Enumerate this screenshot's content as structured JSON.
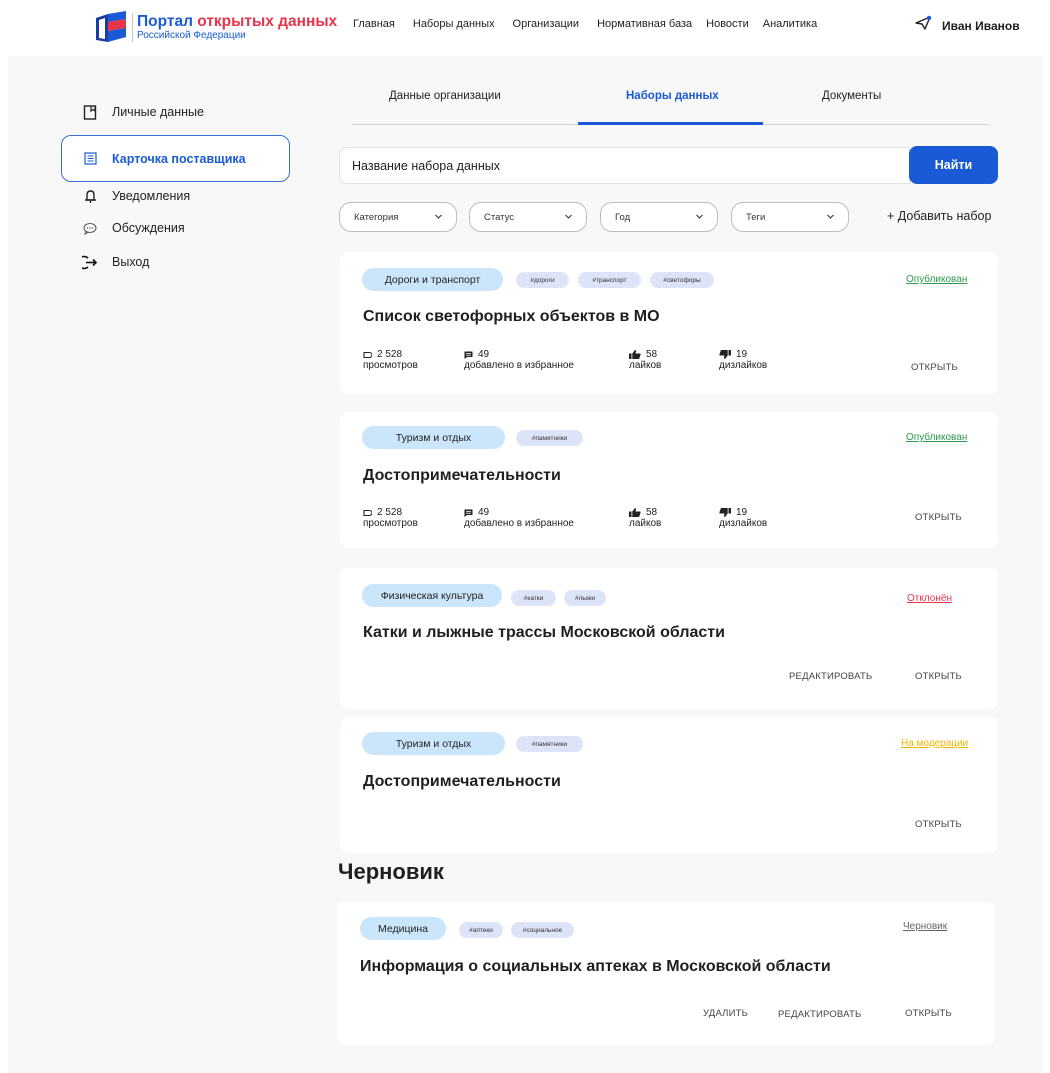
{
  "colors": {
    "accent": "#1a5ad7",
    "brand_red": "#e8344a",
    "published": "#2e9a4f",
    "rejected": "#e8344a",
    "moderation": "#f0b400",
    "draft": "#666666"
  },
  "header": {
    "logo": {
      "title_part1": "Портал",
      "title_part2": "открытых данных",
      "subtitle": "Российской Федерации"
    },
    "nav": [
      "Главная",
      "Наборы данных",
      "Организации",
      "Нормативная база",
      "Новости",
      "Аналитика"
    ],
    "user": {
      "icon": "send-icon",
      "name": "Иван Иванов"
    }
  },
  "sidebar": {
    "items": [
      {
        "label": "Личные данные",
        "icon": "bookmark-icon"
      },
      {
        "label": "Карточка поставщика",
        "icon": "list-card-icon",
        "active": true
      },
      {
        "label": "Уведомления",
        "icon": "bell-icon"
      },
      {
        "label": "Обсуждения",
        "icon": "chat-icon"
      },
      {
        "label": "Выход",
        "icon": "logout-icon"
      }
    ]
  },
  "tabs": [
    {
      "label": "Данные организации"
    },
    {
      "label": "Наборы данных",
      "active": true
    },
    {
      "label": "Документы"
    }
  ],
  "search": {
    "value": "Название набора данных",
    "button": "Найти"
  },
  "filters": [
    "Категория",
    "Статус",
    "Год",
    "Теги"
  ],
  "add_set": "+ Добавить набор",
  "cards": [
    {
      "category": "Дороги и транспорт",
      "tags": [
        "#дороги",
        "#транспорт",
        "#светофоры"
      ],
      "status": "Опубликован",
      "title": "Список светофорных объектов в МО",
      "stats": [
        {
          "value": "2 528",
          "label": "просмотров",
          "icon": "eye-icon"
        },
        {
          "value": "49",
          "label": "добавлено в избранное",
          "icon": "bookmark-filled-icon"
        },
        {
          "value": "58",
          "label": "лайков",
          "icon": "thumbs-up-icon"
        },
        {
          "value": "19",
          "label": "дизлайков",
          "icon": "thumbs-down-icon"
        }
      ],
      "actions": [
        "ОТКРЫТЬ"
      ]
    },
    {
      "category": "Туризм и отдых",
      "tags": [
        "#памятники"
      ],
      "status": "Опубликован",
      "title": "Достопримечательности",
      "stats": [
        {
          "value": "2 528",
          "label": "просмотров",
          "icon": "eye-icon"
        },
        {
          "value": "49",
          "label": "добавлено в избранное",
          "icon": "bookmark-filled-icon"
        },
        {
          "value": "58",
          "label": "лайков",
          "icon": "thumbs-up-icon"
        },
        {
          "value": "19",
          "label": "дизлайков",
          "icon": "thumbs-down-icon"
        }
      ],
      "actions": [
        "ОТКРЫТЬ"
      ]
    },
    {
      "category": "Физическая культура",
      "tags": [
        "#катки",
        "#лыжи"
      ],
      "status": "Отклонён",
      "title": "Катки и лыжные трассы Московской области",
      "actions": [
        "РЕДАКТИРОВАТЬ",
        "ОТКРЫТЬ"
      ]
    },
    {
      "category": "Туризм и отдых",
      "tags": [
        "#памятники"
      ],
      "status": "На модерации",
      "title": "Достопримечательности",
      "actions": [
        "ОТКРЫТЬ"
      ]
    }
  ],
  "draft": {
    "heading": "Черновик",
    "card": {
      "category": "Медицина",
      "tags": [
        "#аптеки",
        "#социальное"
      ],
      "status": "Черновик",
      "title": "Информация о социальных аптеках  в Московской области",
      "actions": [
        "УДАЛИТЬ",
        "РЕДАКТИРОВАТЬ",
        "ОТКРЫТЬ"
      ]
    }
  }
}
